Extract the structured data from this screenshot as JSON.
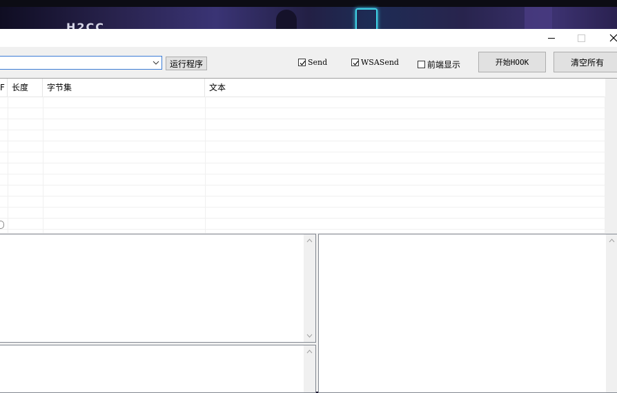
{
  "wallpaper": {
    "logo_text": "H2CC"
  },
  "window": {
    "controls": {
      "minimize": "minimize",
      "maximize": "maximize",
      "close": "close"
    }
  },
  "toolbar": {
    "process_combo_value": "",
    "run_button": "运行程序",
    "checkboxes": [
      {
        "label": "Send",
        "checked": true
      },
      {
        "label": "WSASend",
        "checked": true
      },
      {
        "label": "前端显示",
        "checked": false
      }
    ],
    "start_hook_button": "开始HOOK",
    "clear_all_button": "清空所有"
  },
  "packet_list": {
    "columns": [
      "F",
      "长度",
      "字节集",
      "文本"
    ],
    "rows": []
  },
  "colors": {
    "accent": "#3a7bd5",
    "window_bg": "#f0f0f0",
    "neon": "#3fd4e8"
  }
}
